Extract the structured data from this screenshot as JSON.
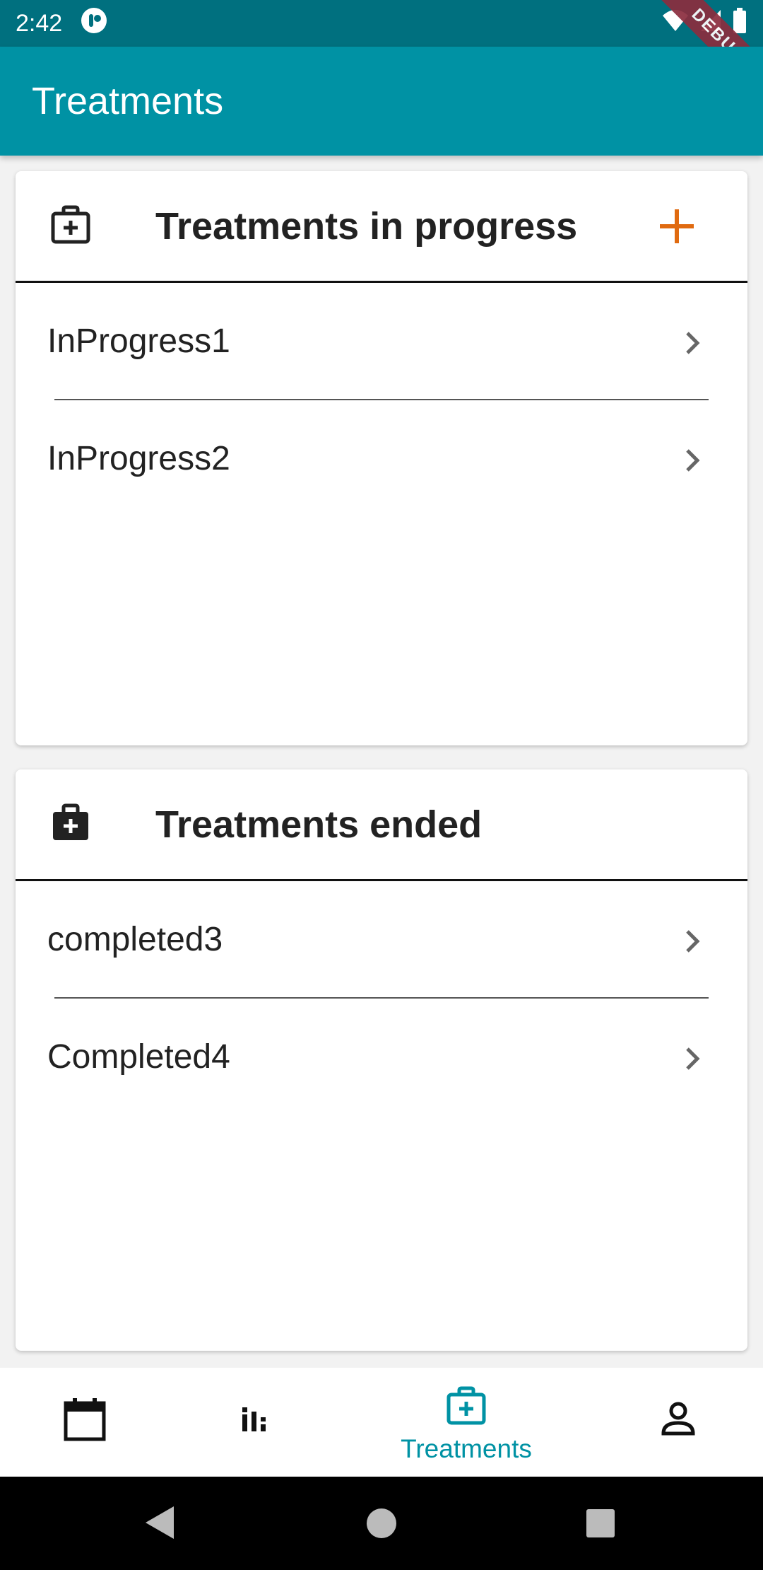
{
  "status_bar": {
    "time": "2:42"
  },
  "debug_banner": "DEBUG",
  "app_bar": {
    "title": "Treatments"
  },
  "in_progress": {
    "heading": "Treatments in progress",
    "items": [
      "InProgress1",
      "InProgress2"
    ]
  },
  "ended": {
    "heading": "Treatments ended",
    "items": [
      "completed3",
      "Completed4"
    ]
  },
  "bottom_nav": {
    "active_label": "Treatments"
  },
  "colors": {
    "primary": "#0092a4",
    "status_bar": "#00707f",
    "accent_add": "#e06a10"
  },
  "icons": [
    "medical-bag-outline-icon",
    "plus-icon",
    "chevron-right-icon",
    "medical-bag-icon",
    "calendar-icon",
    "bar-chart-icon",
    "person-icon",
    "back-icon",
    "home-icon",
    "recents-icon"
  ]
}
